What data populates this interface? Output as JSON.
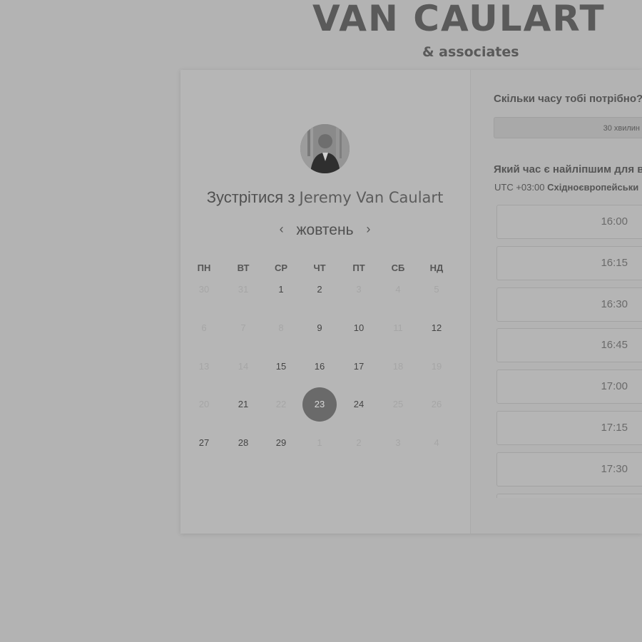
{
  "brand": {
    "name": "VAN CAULART",
    "tagline": "& associates"
  },
  "scheduler": {
    "meet_prefix": "Зустрітися з",
    "host_name": "Jeremy Van Caulart",
    "month": "жовтень",
    "prev_icon": "chevron-left-icon",
    "next_icon": "chevron-right-icon",
    "weekdays": [
      "ПН",
      "ВТ",
      "СР",
      "ЧТ",
      "ПТ",
      "СБ",
      "НД"
    ],
    "weeks": [
      [
        {
          "d": "30",
          "s": "muted"
        },
        {
          "d": "31",
          "s": "muted"
        },
        {
          "d": "1",
          "s": "available"
        },
        {
          "d": "2",
          "s": "available"
        },
        {
          "d": "3",
          "s": "muted"
        },
        {
          "d": "4",
          "s": "muted"
        },
        {
          "d": "5",
          "s": "muted"
        }
      ],
      [
        {
          "d": "6",
          "s": "muted"
        },
        {
          "d": "7",
          "s": "muted"
        },
        {
          "d": "8",
          "s": "muted"
        },
        {
          "d": "9",
          "s": "available"
        },
        {
          "d": "10",
          "s": "available"
        },
        {
          "d": "11",
          "s": "muted"
        },
        {
          "d": "12",
          "s": "available"
        }
      ],
      [
        {
          "d": "13",
          "s": "muted"
        },
        {
          "d": "14",
          "s": "muted"
        },
        {
          "d": "15",
          "s": "available"
        },
        {
          "d": "16",
          "s": "available"
        },
        {
          "d": "17",
          "s": "available"
        },
        {
          "d": "18",
          "s": "muted"
        },
        {
          "d": "19",
          "s": "muted"
        }
      ],
      [
        {
          "d": "20",
          "s": "muted"
        },
        {
          "d": "21",
          "s": "available"
        },
        {
          "d": "22",
          "s": "muted"
        },
        {
          "d": "23",
          "s": "selected"
        },
        {
          "d": "24",
          "s": "available"
        },
        {
          "d": "25",
          "s": "muted"
        },
        {
          "d": "26",
          "s": "muted"
        }
      ],
      [
        {
          "d": "27",
          "s": "available"
        },
        {
          "d": "28",
          "s": "available"
        },
        {
          "d": "29",
          "s": "available"
        },
        {
          "d": "1",
          "s": "muted"
        },
        {
          "d": "2",
          "s": "muted"
        },
        {
          "d": "3",
          "s": "muted"
        },
        {
          "d": "4",
          "s": "muted"
        }
      ]
    ]
  },
  "booking": {
    "duration_question": "Скільки часу тобі потрібно?",
    "duration_value": "30 хвилин",
    "time_question": "Який час є найліпшим для в",
    "timezone_offset": "UTC +03:00",
    "timezone_name": "Східноєвропейськи",
    "slots": [
      "16:00",
      "16:15",
      "16:30",
      "16:45",
      "17:00",
      "17:15",
      "17:30",
      ""
    ]
  },
  "colors": {
    "background": "#b3b3b3",
    "selected_day": "#6a6a6a"
  }
}
